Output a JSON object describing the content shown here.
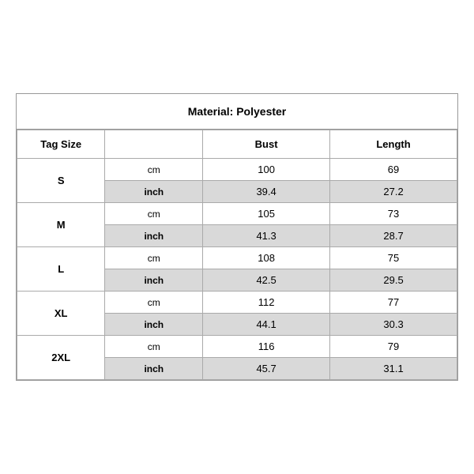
{
  "title": "Material: Polyester",
  "headers": {
    "tag_size": "Tag Size",
    "bust": "Bust",
    "length": "Length"
  },
  "sizes": [
    {
      "tag": "S",
      "rows": [
        {
          "unit": "cm",
          "bust": "100",
          "length": "69",
          "shaded": false
        },
        {
          "unit": "inch",
          "bust": "39.4",
          "length": "27.2",
          "shaded": true
        }
      ]
    },
    {
      "tag": "M",
      "rows": [
        {
          "unit": "cm",
          "bust": "105",
          "length": "73",
          "shaded": false
        },
        {
          "unit": "inch",
          "bust": "41.3",
          "length": "28.7",
          "shaded": true
        }
      ]
    },
    {
      "tag": "L",
      "rows": [
        {
          "unit": "cm",
          "bust": "108",
          "length": "75",
          "shaded": false
        },
        {
          "unit": "inch",
          "bust": "42.5",
          "length": "29.5",
          "shaded": true
        }
      ]
    },
    {
      "tag": "XL",
      "rows": [
        {
          "unit": "cm",
          "bust": "112",
          "length": "77",
          "shaded": false
        },
        {
          "unit": "inch",
          "bust": "44.1",
          "length": "30.3",
          "shaded": true
        }
      ]
    },
    {
      "tag": "2XL",
      "rows": [
        {
          "unit": "cm",
          "bust": "116",
          "length": "79",
          "shaded": false
        },
        {
          "unit": "inch",
          "bust": "45.7",
          "length": "31.1",
          "shaded": true
        }
      ]
    }
  ]
}
